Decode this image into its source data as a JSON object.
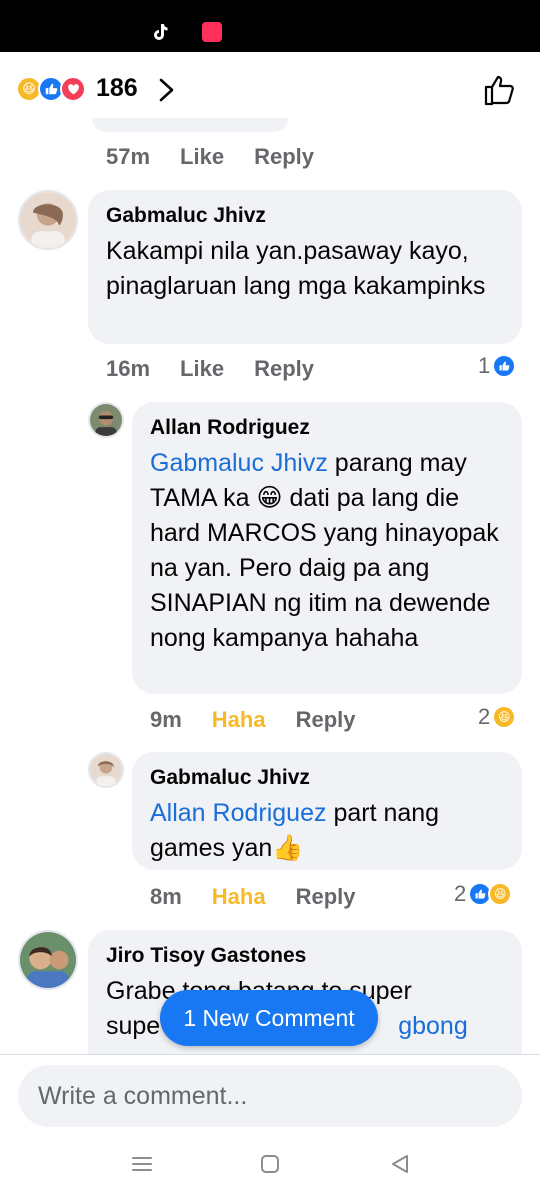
{
  "header": {
    "reaction_count": "186",
    "reaction_icons": [
      "haha-icon",
      "like-icon",
      "love-icon"
    ]
  },
  "previous_comment_meta": {
    "time": "57m",
    "like_label": "Like",
    "reply_label": "Reply"
  },
  "comments": [
    {
      "author": "Gabmaluc Jhivz",
      "text": "Kakampi nila yan.pasaway kayo, pinaglaruan lang mga kakampinks",
      "time": "16m",
      "like_label": "Like",
      "reply_label": "Reply",
      "reaction_count": "1"
    },
    {
      "author": "Allan Rodriguez",
      "mention": "Gabmaluc Jhivz",
      "text": " parang may TAMA ka 😁 dati pa lang die hard MARCOS yang hinayopak na yan. Pero daig pa ang SINAPIAN ng itim na dewende nong kampanya hahaha",
      "time": "9m",
      "like_label": "Haha",
      "reply_label": "Reply",
      "reaction_count": "2"
    },
    {
      "author": "Gabmaluc Jhivz",
      "mention": "Allan Rodriguez",
      "text": " part nang games yan👍",
      "time": "8m",
      "like_label": "Haha",
      "reply_label": "Reply",
      "reaction_count": "2"
    },
    {
      "author": "Jiro Tisoy Gastones",
      "text_line1": "Grabe tong batang to super",
      "text_line2_start": "supe",
      "text_line2_mention": "gbong"
    }
  ],
  "new_comment_pill": "1 New Comment",
  "composer": {
    "placeholder": "Write a comment..."
  },
  "colors": {
    "accent": "#1877f2",
    "haha": "#f7b928",
    "bubble": "#f0f2f5",
    "mention": "#1a6ed8"
  }
}
